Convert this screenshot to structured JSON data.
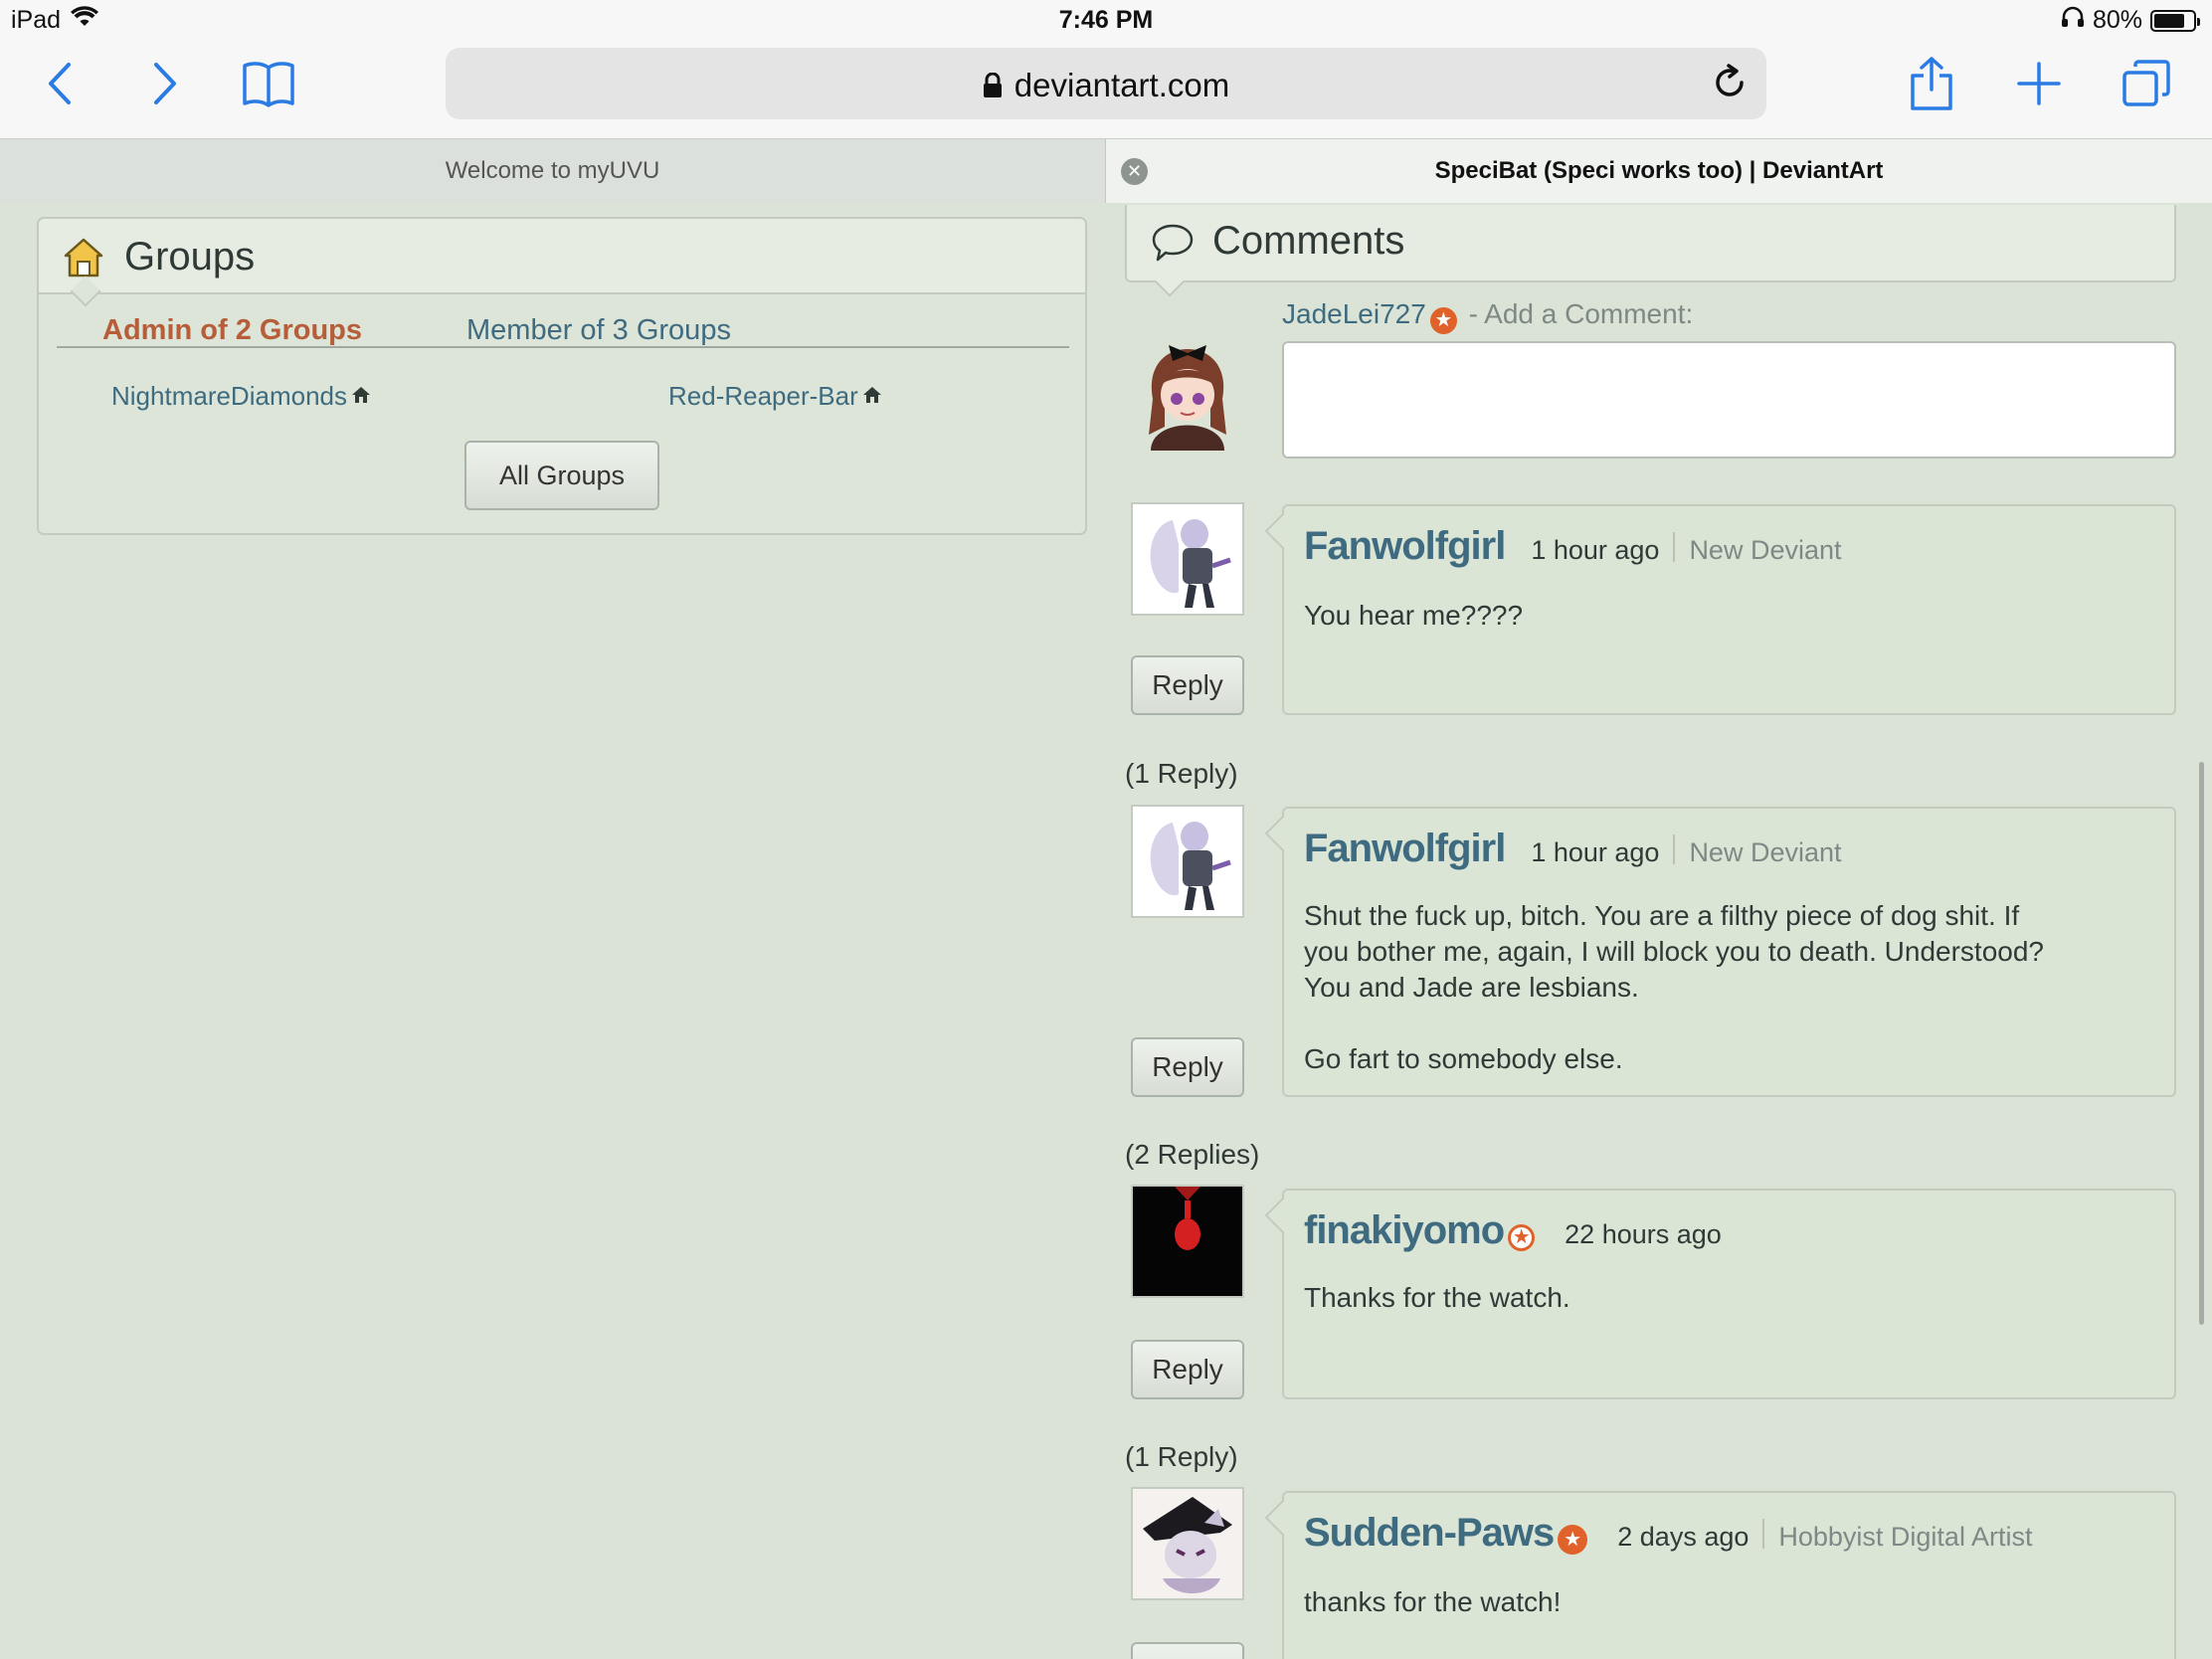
{
  "status_bar": {
    "device": "iPad",
    "time": "7:46 PM",
    "battery": "80%",
    "battery_level": 0.8
  },
  "toolbar": {
    "url": "deviantart.com",
    "icons": [
      "chevron-left-icon",
      "chevron-right-icon",
      "book-icon",
      "reload-icon",
      "share-icon",
      "plus-icon",
      "tabs-icon"
    ]
  },
  "tabs": {
    "left": "Welcome to myUVU",
    "right": "SpeciBat (Speci works too) | DeviantArt"
  },
  "groups": {
    "title": "Groups",
    "admin_tab": "Admin of 2 Groups",
    "member_tab": "Member of 3 Groups",
    "items": [
      "NightmareDiamonds",
      "Red-Reaper-Bar"
    ],
    "all_button": "All Groups"
  },
  "comments": {
    "title": "Comments",
    "current_user": "JadeLei727",
    "add_prompt": "- Add a Comment:",
    "reply_label": "Reply",
    "list": [
      {
        "user": "Fanwolfgirl",
        "time": "1 hour ago",
        "rank": "New Deviant",
        "body": "You hear me????"
      },
      {
        "replies": "(1 Reply)",
        "user": "Fanwolfgirl",
        "time": "1 hour ago",
        "rank": "New Deviant",
        "body_lines": [
          "Shut the fuck up, bitch. You are a filthy piece of dog shit. If",
          "you bother me, again, I will block you to death. Understood?",
          "You and Jade are lesbians.",
          "",
          "Go fart to somebody else."
        ]
      },
      {
        "replies": "(2 Replies)",
        "user": "finakiyomo",
        "time": "22 hours ago",
        "body": "Thanks for the watch."
      },
      {
        "replies": "(1 Reply)",
        "user": "Sudden-Paws",
        "time": "2 days ago",
        "rank": "Hobbyist Digital Artist",
        "body": "thanks for the watch!"
      }
    ]
  },
  "colors": {
    "page_bg": "#dae3d5",
    "link": "#3f6b80",
    "admin_accent": "#b65d3a",
    "badge": "#e0622a"
  }
}
